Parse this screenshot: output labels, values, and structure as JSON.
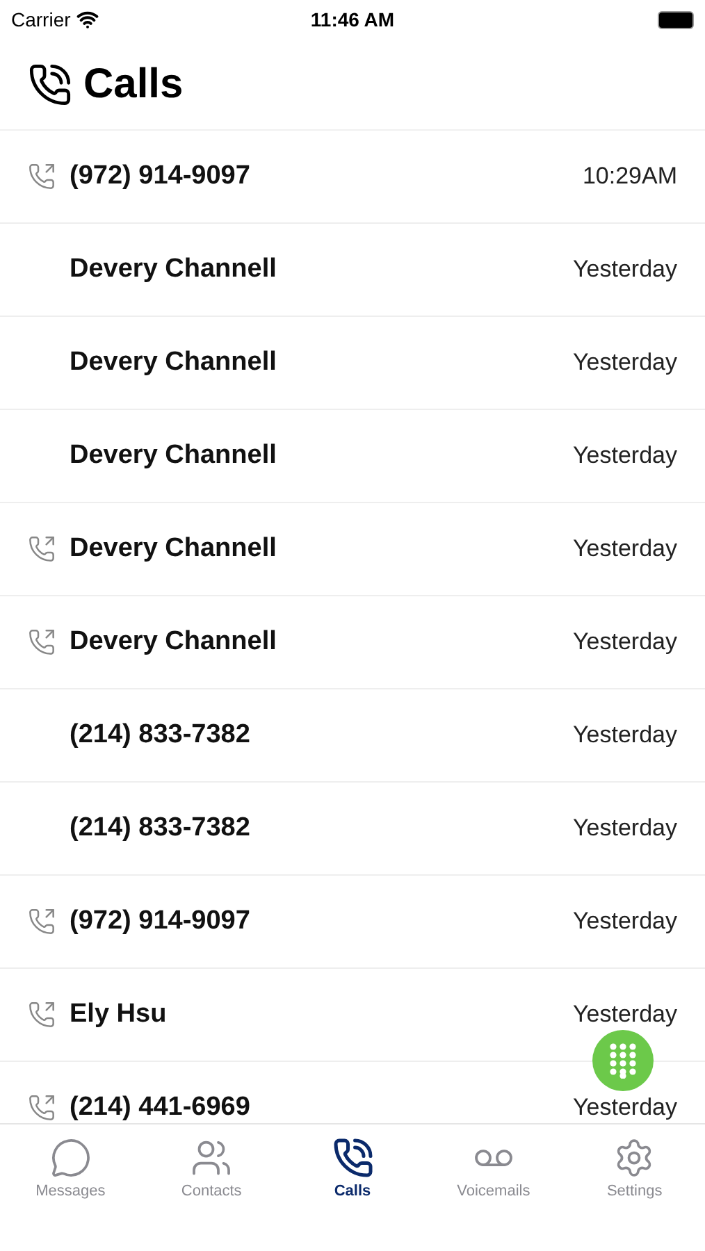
{
  "status_bar": {
    "carrier": "Carrier",
    "time": "11:46 AM"
  },
  "title": "Calls",
  "calls": [
    {
      "name": "(972) 914-9097",
      "time": "10:29AM",
      "outgoing": true
    },
    {
      "name": "Devery Channell",
      "time": "Yesterday",
      "outgoing": false
    },
    {
      "name": "Devery Channell",
      "time": "Yesterday",
      "outgoing": false
    },
    {
      "name": "Devery Channell",
      "time": "Yesterday",
      "outgoing": false
    },
    {
      "name": "Devery Channell",
      "time": "Yesterday",
      "outgoing": true
    },
    {
      "name": "Devery Channell",
      "time": "Yesterday",
      "outgoing": true
    },
    {
      "name": "(214) 833-7382",
      "time": "Yesterday",
      "outgoing": false
    },
    {
      "name": "(214) 833-7382",
      "time": "Yesterday",
      "outgoing": false
    },
    {
      "name": "(972) 914-9097",
      "time": "Yesterday",
      "outgoing": true
    },
    {
      "name": "Ely Hsu",
      "time": "Yesterday",
      "outgoing": true
    },
    {
      "name": "(214) 441-6969",
      "time": "Yesterday",
      "outgoing": true
    }
  ],
  "tabs": [
    {
      "kind": "messages",
      "label": "Messages",
      "selected": false
    },
    {
      "kind": "contacts",
      "label": "Contacts",
      "selected": false
    },
    {
      "kind": "calls",
      "label": "Calls",
      "selected": true
    },
    {
      "kind": "voicemails",
      "label": "Voicemails",
      "selected": false
    },
    {
      "kind": "settings",
      "label": "Settings",
      "selected": false
    }
  ]
}
